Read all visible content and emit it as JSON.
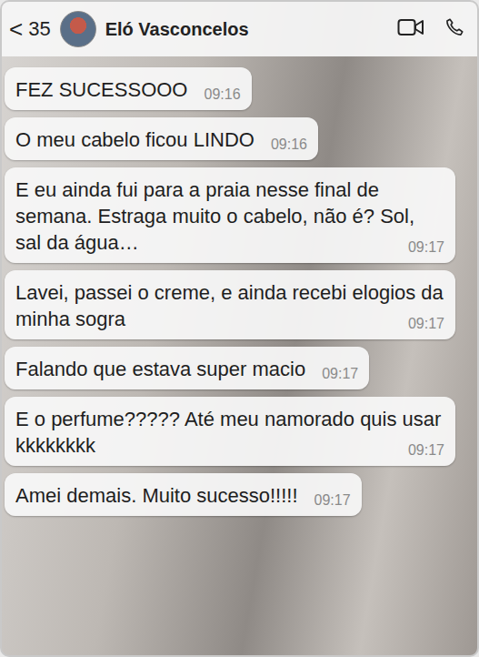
{
  "header": {
    "back": "<",
    "count": "35",
    "name": "Eló Vasconcelos"
  },
  "messages": [
    {
      "text": "FEZ SUCESSOOO",
      "time": "09:16"
    },
    {
      "text": "O meu cabelo ficou LINDO",
      "time": "09:16"
    },
    {
      "text": "E eu ainda fui para a praia nesse final de semana. Estraga muito o cabelo, não é? Sol, sal da água…",
      "time": "09:17"
    },
    {
      "text": "Lavei, passei o creme, e ainda recebi elogios da minha sogra",
      "time": "09:17"
    },
    {
      "text": "Falando que estava super macio",
      "time": "09:17"
    },
    {
      "text": "E o perfume????? Até meu namorado quis usar kkkkkkkk",
      "time": "09:17"
    },
    {
      "text": "Amei demais. Muito sucesso!!!!!",
      "time": "09:17"
    }
  ]
}
